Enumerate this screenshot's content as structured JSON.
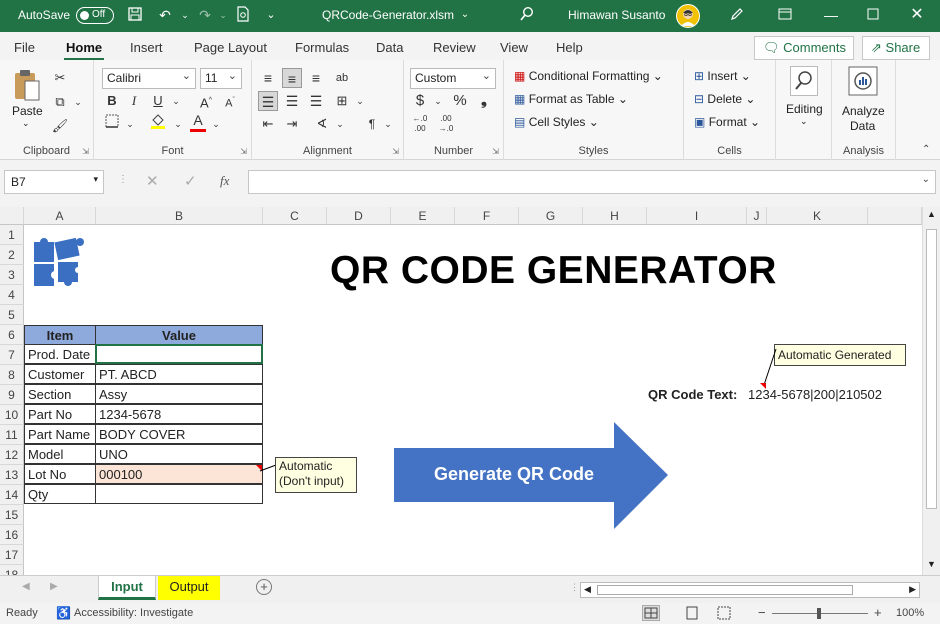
{
  "titlebar": {
    "autosave": "AutoSave",
    "toggle": "Off",
    "filename": "QRCode-Generator.xlsm",
    "user": "Himawan Susanto"
  },
  "ribbon_tabs": [
    "File",
    "Home",
    "Insert",
    "Page Layout",
    "Formulas",
    "Data",
    "Review",
    "View",
    "Help"
  ],
  "comments": "Comments",
  "share": "Share",
  "ribbon": {
    "clipboard": {
      "paste": "Paste",
      "label": "Clipboard"
    },
    "font": {
      "name": "Calibri",
      "size": "11",
      "label": "Font"
    },
    "alignment": {
      "label": "Alignment"
    },
    "number": {
      "format": "Custom",
      "label": "Number"
    },
    "styles": {
      "cond": "Conditional Formatting",
      "table": "Format as Table",
      "cell": "Cell Styles",
      "label": "Styles"
    },
    "cells": {
      "insert": "Insert",
      "delete": "Delete",
      "format": "Format",
      "label": "Cells"
    },
    "editing": {
      "label": "Editing"
    },
    "analysis": {
      "analyze": "Analyze",
      "data": "Data",
      "label": "Analysis"
    }
  },
  "namebox": "B7",
  "columns": [
    "A",
    "B",
    "C",
    "D",
    "E",
    "F",
    "G",
    "H",
    "I",
    "J",
    "K"
  ],
  "rows": [
    "1",
    "2",
    "3",
    "4",
    "5",
    "6",
    "7",
    "8",
    "9",
    "10",
    "11",
    "12",
    "13",
    "14",
    "15",
    "16",
    "17",
    "18"
  ],
  "sheet": {
    "title": "QR CODE GENERATOR",
    "table_header": {
      "item": "Item",
      "value": "Value"
    },
    "table_rows": [
      {
        "item": "Prod. Date",
        "value": ""
      },
      {
        "item": "Customer",
        "value": "PT. ABCD"
      },
      {
        "item": "Section",
        "value": "Assy"
      },
      {
        "item": "Part No",
        "value": "1234-5678"
      },
      {
        "item": "Part Name",
        "value": "BODY COVER"
      },
      {
        "item": "Model",
        "value": "UNO"
      },
      {
        "item": "Lot No",
        "value": "000100"
      },
      {
        "item": "Qty",
        "value": ""
      }
    ],
    "callout_auto_line1": "Automatic",
    "callout_auto_line2": "(Don't input)",
    "callout_generated": "Automatic Generated",
    "qr_label": "QR Code Text:",
    "qr_value": "1234-5678|200|210502",
    "button": "Generate QR Code"
  },
  "sheet_tabs": [
    "Input",
    "Output"
  ],
  "status": {
    "ready": "Ready",
    "accessibility": "Accessibility: Investigate",
    "zoom": "100%"
  },
  "colors": {
    "excel_green": "#217346",
    "header_blue": "#8ea9db",
    "arrow_blue": "#4472c4",
    "lot_fill": "#fce4d6",
    "output_tab": "#ffff00"
  }
}
